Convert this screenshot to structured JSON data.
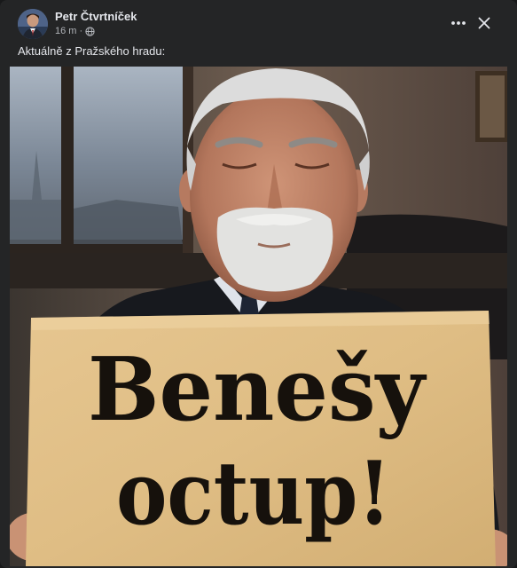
{
  "post": {
    "author": "Petr Čtvrtníček",
    "time": "16 m",
    "separator": "·",
    "caption": "Aktuálně z Pražského hradu:"
  },
  "image": {
    "sign_line1": "Benešy",
    "sign_line2": "octup!"
  },
  "icons": {
    "more": "more-horizontal-icon",
    "close": "close-icon",
    "audience": "globe-icon"
  },
  "colors": {
    "card_background": "#242526",
    "primary_text": "#e4e6eb",
    "secondary_text": "#b0b3b8",
    "sign_paper": "#e6c690"
  }
}
